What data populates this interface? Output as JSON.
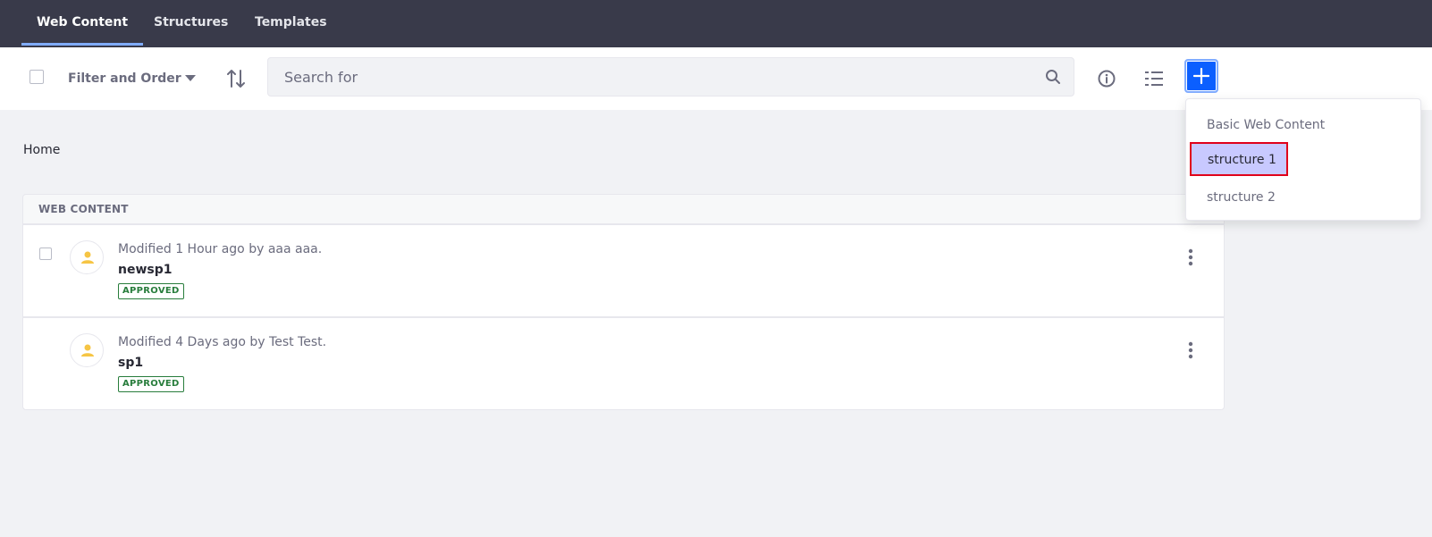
{
  "nav": {
    "tabs": [
      {
        "label": "Web Content",
        "active": true
      },
      {
        "label": "Structures",
        "active": false
      },
      {
        "label": "Templates",
        "active": false
      }
    ]
  },
  "toolbar": {
    "filter_label": "Filter and Order",
    "search_placeholder": "Search for",
    "add_button_icon": "plus-icon"
  },
  "dropdown": {
    "items": [
      {
        "label": "Basic Web Content",
        "highlighted": false
      },
      {
        "label": "structure 1",
        "highlighted": true
      },
      {
        "label": "structure 2",
        "highlighted": false
      }
    ]
  },
  "breadcrumb": {
    "label": "Home"
  },
  "list": {
    "header": "WEB CONTENT",
    "rows": [
      {
        "meta": "Modified 1 Hour ago by aaa aaa.",
        "title": "newsp1",
        "status": "APPROVED"
      },
      {
        "meta": "Modified 4 Days ago by Test Test.",
        "title": "sp1",
        "status": "APPROVED"
      }
    ]
  },
  "colors": {
    "nav_bg": "#393a4a",
    "accent": "#0b5fff",
    "approved": "#287d3c",
    "highlight_bg": "#c8c9ff",
    "highlight_border": "#e0001b",
    "avatar_icon": "#f6c544"
  }
}
